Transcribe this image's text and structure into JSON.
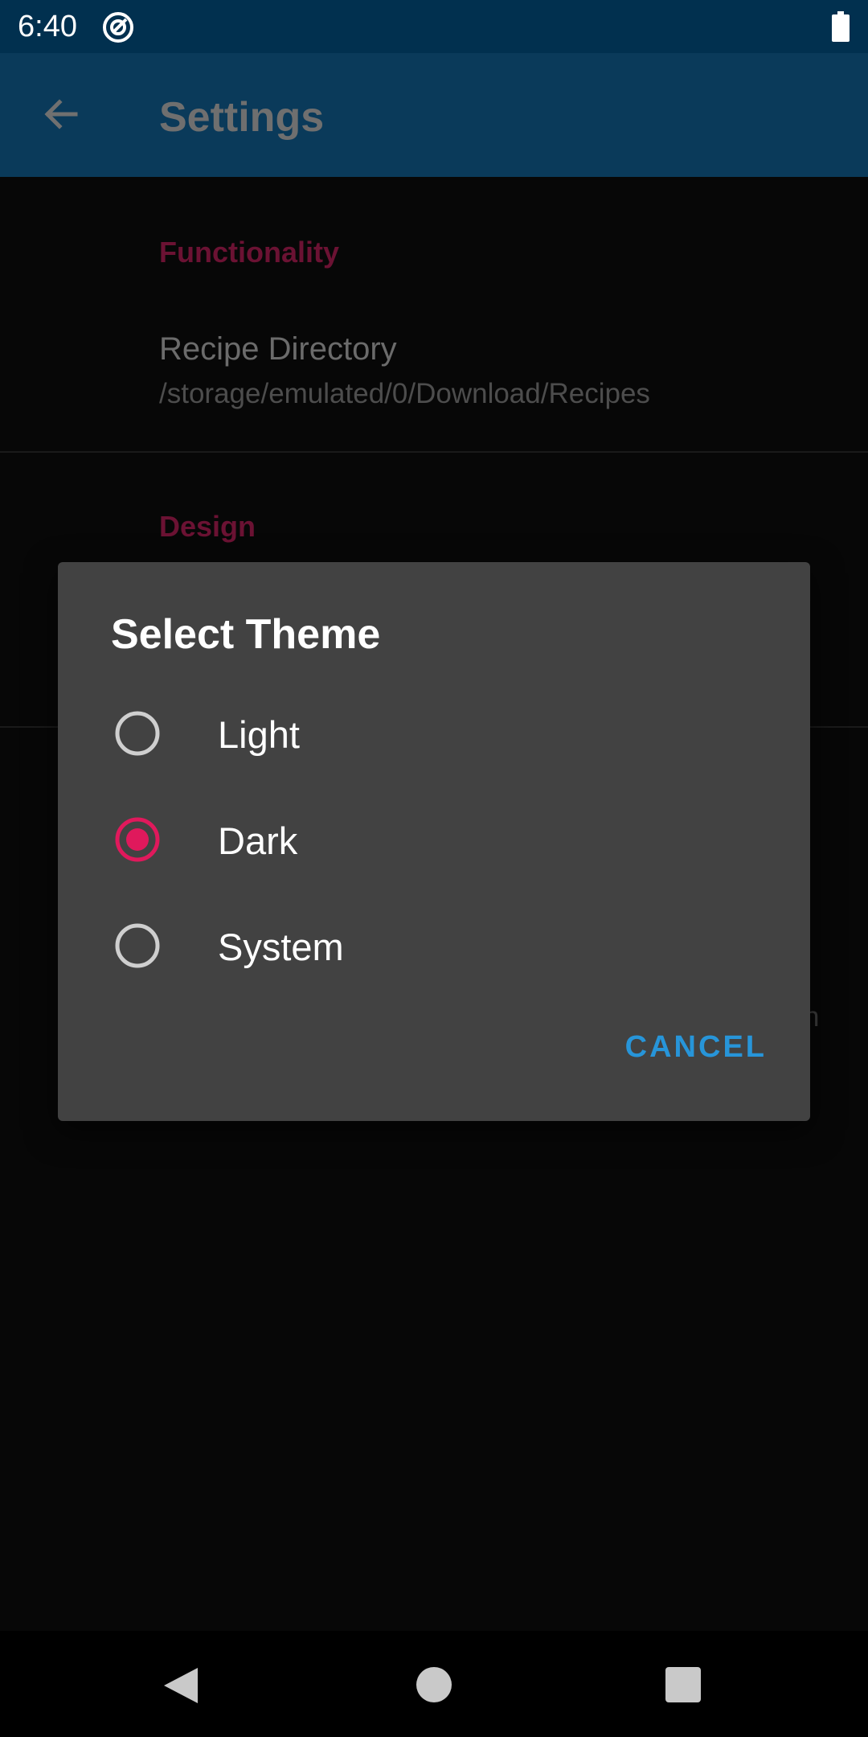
{
  "status_bar": {
    "time": "6:40"
  },
  "app_bar": {
    "title": "Settings"
  },
  "settings": {
    "functionality_header": "Functionality",
    "recipe_directory_title": "Recipe Directory",
    "recipe_directory_path": "/storage/emulated/0/Download/Recipes",
    "design_header": "Design",
    "peek_text": "n"
  },
  "dialog": {
    "title": "Select Theme",
    "options": [
      {
        "label": "Light",
        "selected": false
      },
      {
        "label": "Dark",
        "selected": true
      },
      {
        "label": "System",
        "selected": false
      }
    ],
    "cancel_label": "CANCEL"
  },
  "colors": {
    "accent": "#e0195c",
    "primary": "#0a3a5a",
    "button_text": "#2795d9"
  },
  "icons": {
    "status_app": "target-icon",
    "battery": "battery-icon",
    "back": "arrow-back-icon",
    "nav_back": "triangle-back-icon",
    "nav_home": "circle-home-icon",
    "nav_recents": "square-recents-icon"
  }
}
